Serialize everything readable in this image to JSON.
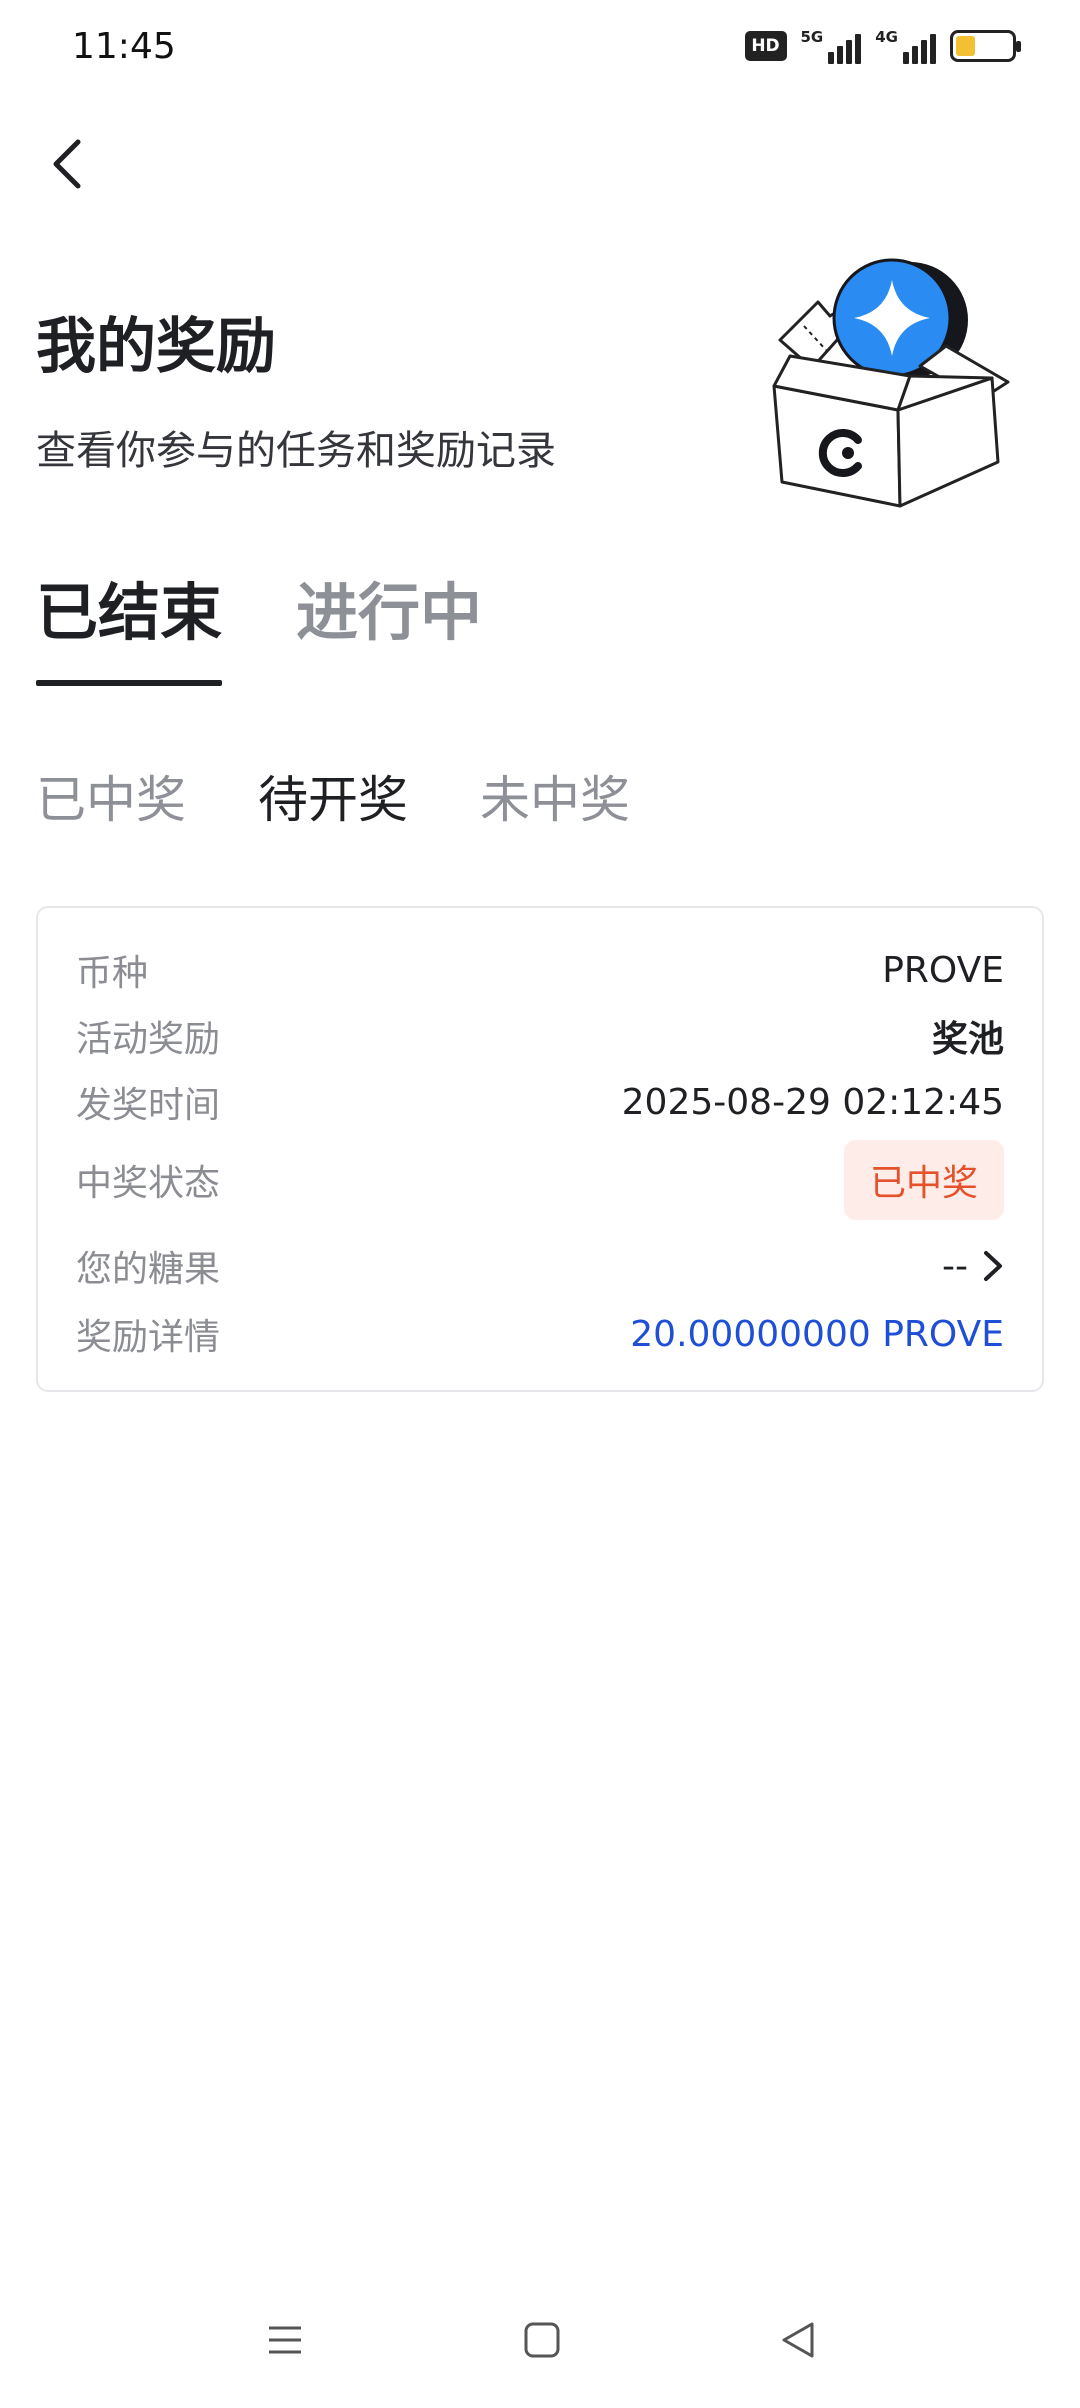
{
  "status_bar": {
    "time": "11:45",
    "hd_label": "HD",
    "net1_label": "5G",
    "net2_label": "4G",
    "battery_level": 0.35,
    "battery_color": "#f3c033",
    "icons": [
      "hd-voice-icon",
      "signal-5g-icon",
      "signal-4g-icon",
      "battery-icon"
    ]
  },
  "header": {
    "back_icon": "chevron-left-icon",
    "title": "我的奖励",
    "subtitle": "查看你参与的任务和奖励记录",
    "illustration": "reward-box-illustration"
  },
  "main_tabs": [
    {
      "label": "已结束",
      "active": true
    },
    {
      "label": "进行中",
      "active": false
    }
  ],
  "sub_tabs": [
    {
      "label": "已中奖",
      "active": false
    },
    {
      "label": "待开奖",
      "active": true
    },
    {
      "label": "未中奖",
      "active": false
    }
  ],
  "card": {
    "rows": [
      {
        "label": "币种",
        "value": "PROVE"
      },
      {
        "label": "活动奖励",
        "value": "奖池"
      },
      {
        "label": "发奖时间",
        "value": "2025-08-29 02:12:45"
      },
      {
        "label": "中奖状态",
        "value": "已中奖"
      },
      {
        "label": "您的糖果",
        "value": "--"
      },
      {
        "label": "奖励详情",
        "value": "20.00000000 PROVE"
      }
    ]
  },
  "colors": {
    "accent_blue": "#1f4fd6",
    "status_red": "#e5512a",
    "status_bg": "#fdece7",
    "text_primary": "#1f2024",
    "text_secondary": "#8b8d93"
  },
  "nav_bar": {
    "icons": [
      "menu-icon",
      "home-square-icon",
      "back-triangle-icon"
    ]
  }
}
